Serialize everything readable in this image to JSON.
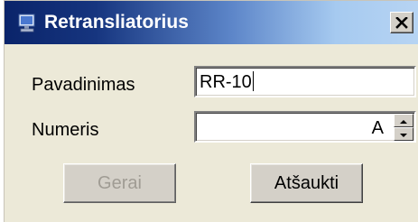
{
  "window": {
    "title": "Retransliatorius",
    "title_icon": "computer-icon",
    "close_icon": "close-icon"
  },
  "form": {
    "name_label": "Pavadinimas",
    "name_value": "RR-10",
    "number_label": "Numeris",
    "number_value": "A",
    "spin_up_icon": "spin-up-icon",
    "spin_down_icon": "spin-down-icon"
  },
  "buttons": {
    "ok_label": "Gerai",
    "ok_enabled": false,
    "cancel_label": "Atšaukti"
  },
  "colors": {
    "titlebar_start": "#0a246a",
    "titlebar_end": "#b7d4f3",
    "window_bg": "#ece9d8",
    "disabled_text": "#a09c94"
  }
}
